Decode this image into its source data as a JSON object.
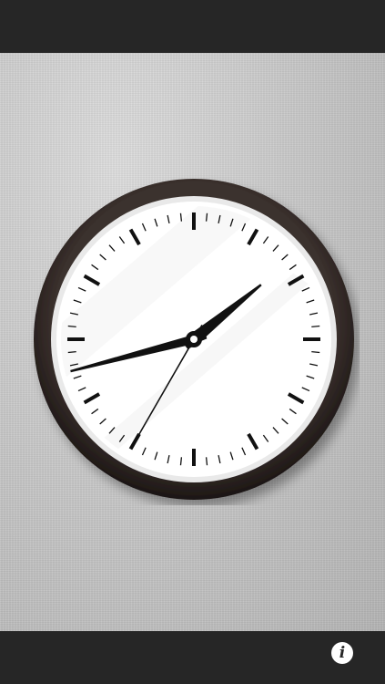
{
  "clock": {
    "time": {
      "hours": 1,
      "minutes": 42,
      "seconds": 35
    },
    "colors": {
      "rim": "#2a2220",
      "face": "#ffffff",
      "hands": "#111111",
      "background": "#c8c8c8"
    }
  },
  "info_button": {
    "icon": "info-icon",
    "glyph": "i"
  },
  "bars": {
    "top_color": "#262626",
    "bottom_color": "#262626"
  }
}
